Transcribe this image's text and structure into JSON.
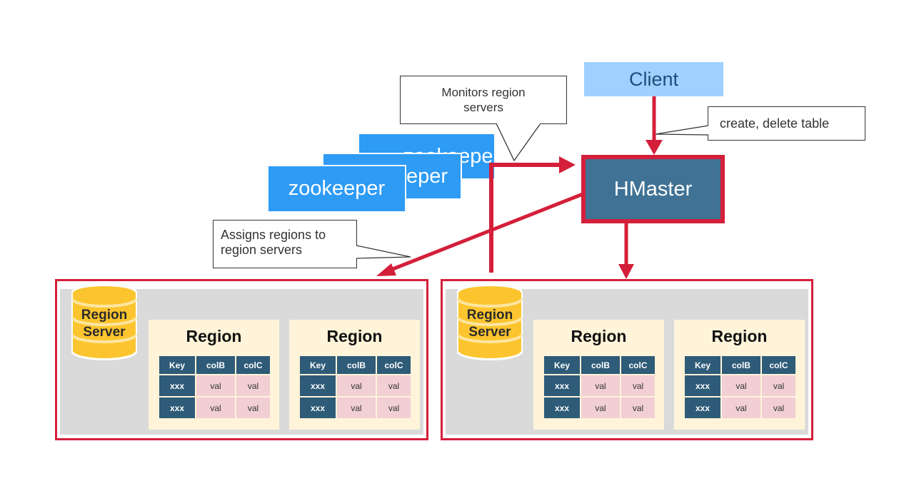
{
  "colors": {
    "client_fill": "#9fd0ff",
    "client_text": "#1f4e79",
    "hmaster_fill": "#3f7294",
    "hmaster_border": "#d41f3a",
    "zookeeper_fill": "#2e9bf5",
    "arrow": "#d41f3a",
    "region_server_border": "#d41f3a",
    "region_server_bg": "#dadada",
    "region_fill": "#fff4d9",
    "db_fill": "#fcc52f",
    "table_header": "#2e5b78",
    "table_cell": "#f1cfd4"
  },
  "client": {
    "label": "Client"
  },
  "hmaster": {
    "label": "HMaster"
  },
  "zookeepers": [
    {
      "label": "zookeeper"
    },
    {
      "label": "zookeeper"
    },
    {
      "label": "zookeeper"
    }
  ],
  "callouts": {
    "monitors": {
      "line1": "Monitors region",
      "line2": "servers"
    },
    "create": {
      "text": "create, delete table"
    },
    "assigns": {
      "line1": "Assigns regions to",
      "line2": "region servers"
    }
  },
  "region_servers": [
    {
      "label_line1": "Region",
      "label_line2": "Server",
      "regions": [
        {
          "title": "Region",
          "headers": [
            "Key",
            "colB",
            "colC"
          ],
          "rows": [
            [
              "xxx",
              "val",
              "val"
            ],
            [
              "xxx",
              "val",
              "val"
            ]
          ]
        },
        {
          "title": "Region",
          "headers": [
            "Key",
            "colB",
            "colC"
          ],
          "rows": [
            [
              "xxx",
              "val",
              "val"
            ],
            [
              "xxx",
              "val",
              "val"
            ]
          ]
        }
      ]
    },
    {
      "label_line1": "Region",
      "label_line2": "Server",
      "regions": [
        {
          "title": "Region",
          "headers": [
            "Key",
            "colB",
            "colC"
          ],
          "rows": [
            [
              "xxx",
              "val",
              "val"
            ],
            [
              "xxx",
              "val",
              "val"
            ]
          ]
        },
        {
          "title": "Region",
          "headers": [
            "Key",
            "colB",
            "colC"
          ],
          "rows": [
            [
              "xxx",
              "val",
              "val"
            ],
            [
              "xxx",
              "val",
              "val"
            ]
          ]
        }
      ]
    }
  ]
}
